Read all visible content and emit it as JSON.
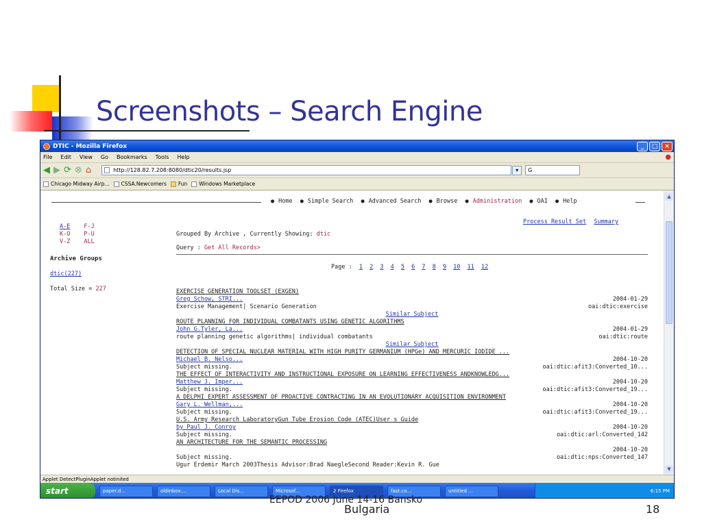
{
  "slide": {
    "title": "Screenshots – Search Engine",
    "footer_line1": "EEPOD 2006 June 14-16  Bansko",
    "footer_line2": "Bulgaria",
    "number": "18"
  },
  "browser": {
    "title": "DTIC - Mozilla Firefox",
    "menu": [
      "File",
      "Edit",
      "View",
      "Go",
      "Bookmarks",
      "Tools",
      "Help"
    ],
    "url": "http://128.82.7.208:8080/dtic20/results.jsp",
    "bookmarks": [
      "Chicago Midway Airp...",
      "CSSA.Newcomers",
      "Fun",
      "Windows Marketplace"
    ],
    "status": "Applet DetectPluginApplet notinited"
  },
  "page": {
    "nav": [
      "Home",
      "Simple Search",
      "Advanced Search",
      "Browse",
      "Administration",
      "OAI",
      "Help"
    ],
    "alpha": [
      [
        "A-E",
        "F-J"
      ],
      [
        "K-O",
        "P-U"
      ],
      [
        "V-Z",
        "ALL"
      ]
    ],
    "archive_groups_label": "Archive Groups",
    "archive_link": "dtic(227)",
    "total_size_label": "Total Size = ",
    "total_size_value": "227",
    "process_link": "Process Result Set",
    "summary_link": "Summary",
    "grouped_label": "Grouped By Archive , Currently Showing: ",
    "grouped_value": "dtic",
    "query_label": "Query : ",
    "query_value": "Get All Records>",
    "page_label": "Page :",
    "pages": [
      "1",
      "2",
      "3",
      "4",
      "5",
      "6",
      "7",
      "8",
      "9",
      "10",
      "11",
      "12"
    ],
    "similar_label": "Similar Subject",
    "results": [
      {
        "title": "EXERCISE GENERATION TOOLSET (EXGEN)",
        "author": "Greg Schow, STRI...",
        "date": "2004-01-29",
        "subject": "Exercise Management| Scenario Generation",
        "oai": "oai:dtic:exercise"
      },
      {
        "title": "ROUTE PLANNING FOR INDIVIDUAL COMBATANTS USING GENETIC ALGORITHMS",
        "author": "John G.Tyler, La...",
        "date": "2004-01-29",
        "subject": "route planning genetic algorithms| individual combatants",
        "oai": "oai:dtic:route"
      },
      {
        "title": "DETECTION OF SPECIAL NUCLEAR MATERIAL WITH HIGH PURITY GERMANIUM (HPGe) AND MERCURIC IODIDE ...",
        "author": "Michael B. Nelso...",
        "date": "2004-10-20",
        "subject": "Subject missing.",
        "oai": "oai:dtic:afit3:Converted_10..."
      },
      {
        "title": "THE EFFECT OF INTERACTIVITY AND INSTRUCTIONAL EXPOSURE ON LEARNING EFFECTIVENESS ANDKNOWLEDG...",
        "author": "Matthew J. Imper...",
        "date": "2004-10-20",
        "subject": "Subject missing.",
        "oai": "oai:dtic:afit3:Converted_19..."
      },
      {
        "title": "A DELPHI EXPERT ASSESSMENT OF PROACTIVE CONTRACTING IN AN EVOLUTIONARY ACQUISITION ENVIRONMENT",
        "author": "Gary L. Wellman,...",
        "date": "2004-10-20",
        "subject": "Subject missing.",
        "oai": "oai:dtic:afit3:Converted_19..."
      },
      {
        "title": "U.S. Army Research LaboratoryGun Tube Erosion Code (ATEC)User s Guide",
        "author": "by Paul J. Conroy",
        "date": "2004-10-20",
        "subject": "Subject missing.",
        "oai": "oai:dtic:arl:Converted_142"
      },
      {
        "title": "AN ARCHITECTURE FOR THE SEMANTIC PROCESSING",
        "author": "",
        "date": "2004-10-20",
        "subject": "Subject missing.",
        "oai": "oai:dtic:nps:Converted_147"
      }
    ],
    "last_line": "Ugur Erdemir March 2003Thesis Advisor:Brad NaegleSecond Reader:Kevin R. Gue"
  },
  "taskbar": {
    "start": "start",
    "tasks": [
      "paper.d...",
      "oldinbox....",
      "Local Dis...",
      "Microsof...",
      "2 Firefox",
      "fast.co...",
      "untitled ..."
    ],
    "clock": "6:15 PM"
  },
  "colors": {
    "slide_title": "#333399",
    "link": "#2233aa",
    "highlight": "#a01f4e",
    "titlebar": "#0a4fd8"
  }
}
